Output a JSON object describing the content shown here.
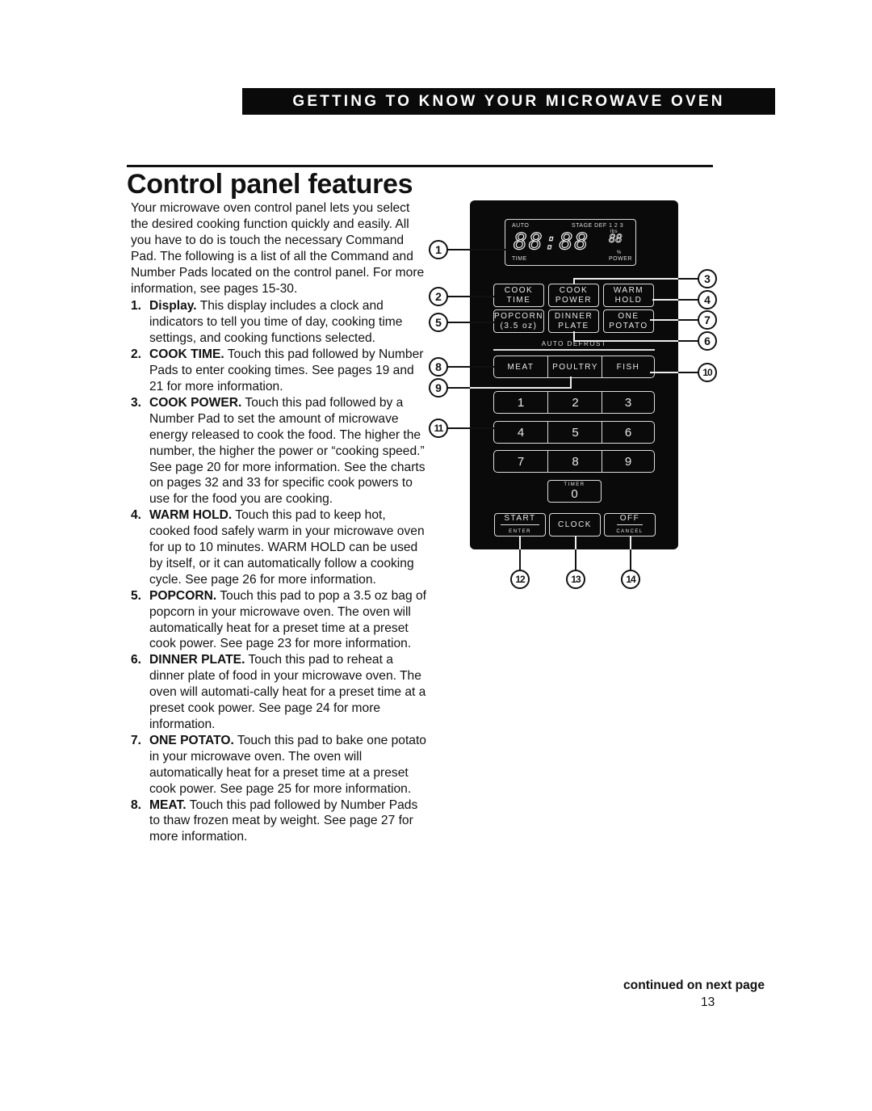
{
  "header": {
    "banner": "GETTING TO KNOW YOUR MICROWAVE OVEN"
  },
  "page": {
    "title": "Control panel features",
    "intro": "Your microwave oven control panel lets you select the desired cooking function quickly and easily. All you have to do is touch the necessary Command Pad. The following is a list of all the Command and Number Pads located on the control panel. For more information, see pages 15-30.",
    "items": [
      {
        "num": "1.",
        "term": "Display.",
        "text": " This display includes a clock and indicators to tell you time of day, cooking time settings, and cooking functions selected."
      },
      {
        "num": "2.",
        "term": "COOK TIME.",
        "text": " Touch this pad followed by Number Pads to enter cooking times. See pages 19 and 21 for more information."
      },
      {
        "num": "3.",
        "term": "COOK POWER.",
        "text": " Touch this pad followed by a Number Pad to set the amount of microwave energy released to cook the food. The higher the number, the higher the power or “cooking speed.” See page 20 for more information. See the charts on pages 32 and 33 for specific cook powers to use for the food you are cooking."
      },
      {
        "num": "4.",
        "term": "WARM HOLD.",
        "text": " Touch this pad to keep hot, cooked food safely warm in your microwave oven for up to 10 minutes. WARM HOLD can be used by itself, or it can automatically follow a cooking cycle. See page 26 for more information."
      },
      {
        "num": "5.",
        "term": "POPCORN.",
        "text": " Touch this pad to pop a 3.5 oz bag of popcorn in your microwave oven. The oven will automatically heat for a preset time at a preset cook power. See page 23 for more information."
      },
      {
        "num": "6.",
        "term": "DINNER PLATE.",
        "text": " Touch this pad to reheat a dinner plate of food in your microwave oven. The oven will automati-cally heat for a preset time at a preset cook power. See page 24 for more information."
      },
      {
        "num": "7.",
        "term": "ONE POTATO.",
        "text": " Touch this pad to bake one potato in your microwave oven. The oven will automatically heat for a preset time at a preset cook power. See page 25 for more information."
      },
      {
        "num": "8.",
        "term": "MEAT.",
        "text": " Touch this pad followed by Number Pads to thaw frozen meat by weight. See page 27 for more information."
      }
    ],
    "continued": "continued on next page",
    "page_number": "13"
  },
  "panel": {
    "display": {
      "auto": "AUTO",
      "stage": "STAGE DEF 1  2  3",
      "digits": "88:88",
      "mini_digits": "88",
      "lbs": "lbs",
      "pct": "%",
      "time": "TIME",
      "power": "POWER"
    },
    "pads": {
      "cook_time": [
        "COOK",
        "TIME"
      ],
      "cook_power": [
        "COOK",
        "POWER"
      ],
      "warm_hold": [
        "WARM",
        "HOLD"
      ],
      "popcorn": [
        "POPCORN",
        "(3.5 oz)"
      ],
      "dinner_plate": [
        "DINNER",
        "PLATE"
      ],
      "one_potato": [
        "ONE",
        "POTATO"
      ],
      "auto_defrost": "AUTO DEFROST",
      "meat": "MEAT",
      "poultry": "POULTRY",
      "fish": "FISH",
      "numbers": [
        "1",
        "2",
        "3",
        "4",
        "5",
        "6",
        "7",
        "8",
        "9"
      ],
      "zero_top": "TIMER",
      "zero": "0",
      "start": "START",
      "enter": "ENTER",
      "clock": "CLOCK",
      "off": "OFF",
      "cancel": "CANCEL"
    },
    "callouts": [
      "1",
      "2",
      "3",
      "4",
      "5",
      "6",
      "7",
      "8",
      "9",
      "10",
      "11",
      "12",
      "13",
      "14"
    ]
  }
}
